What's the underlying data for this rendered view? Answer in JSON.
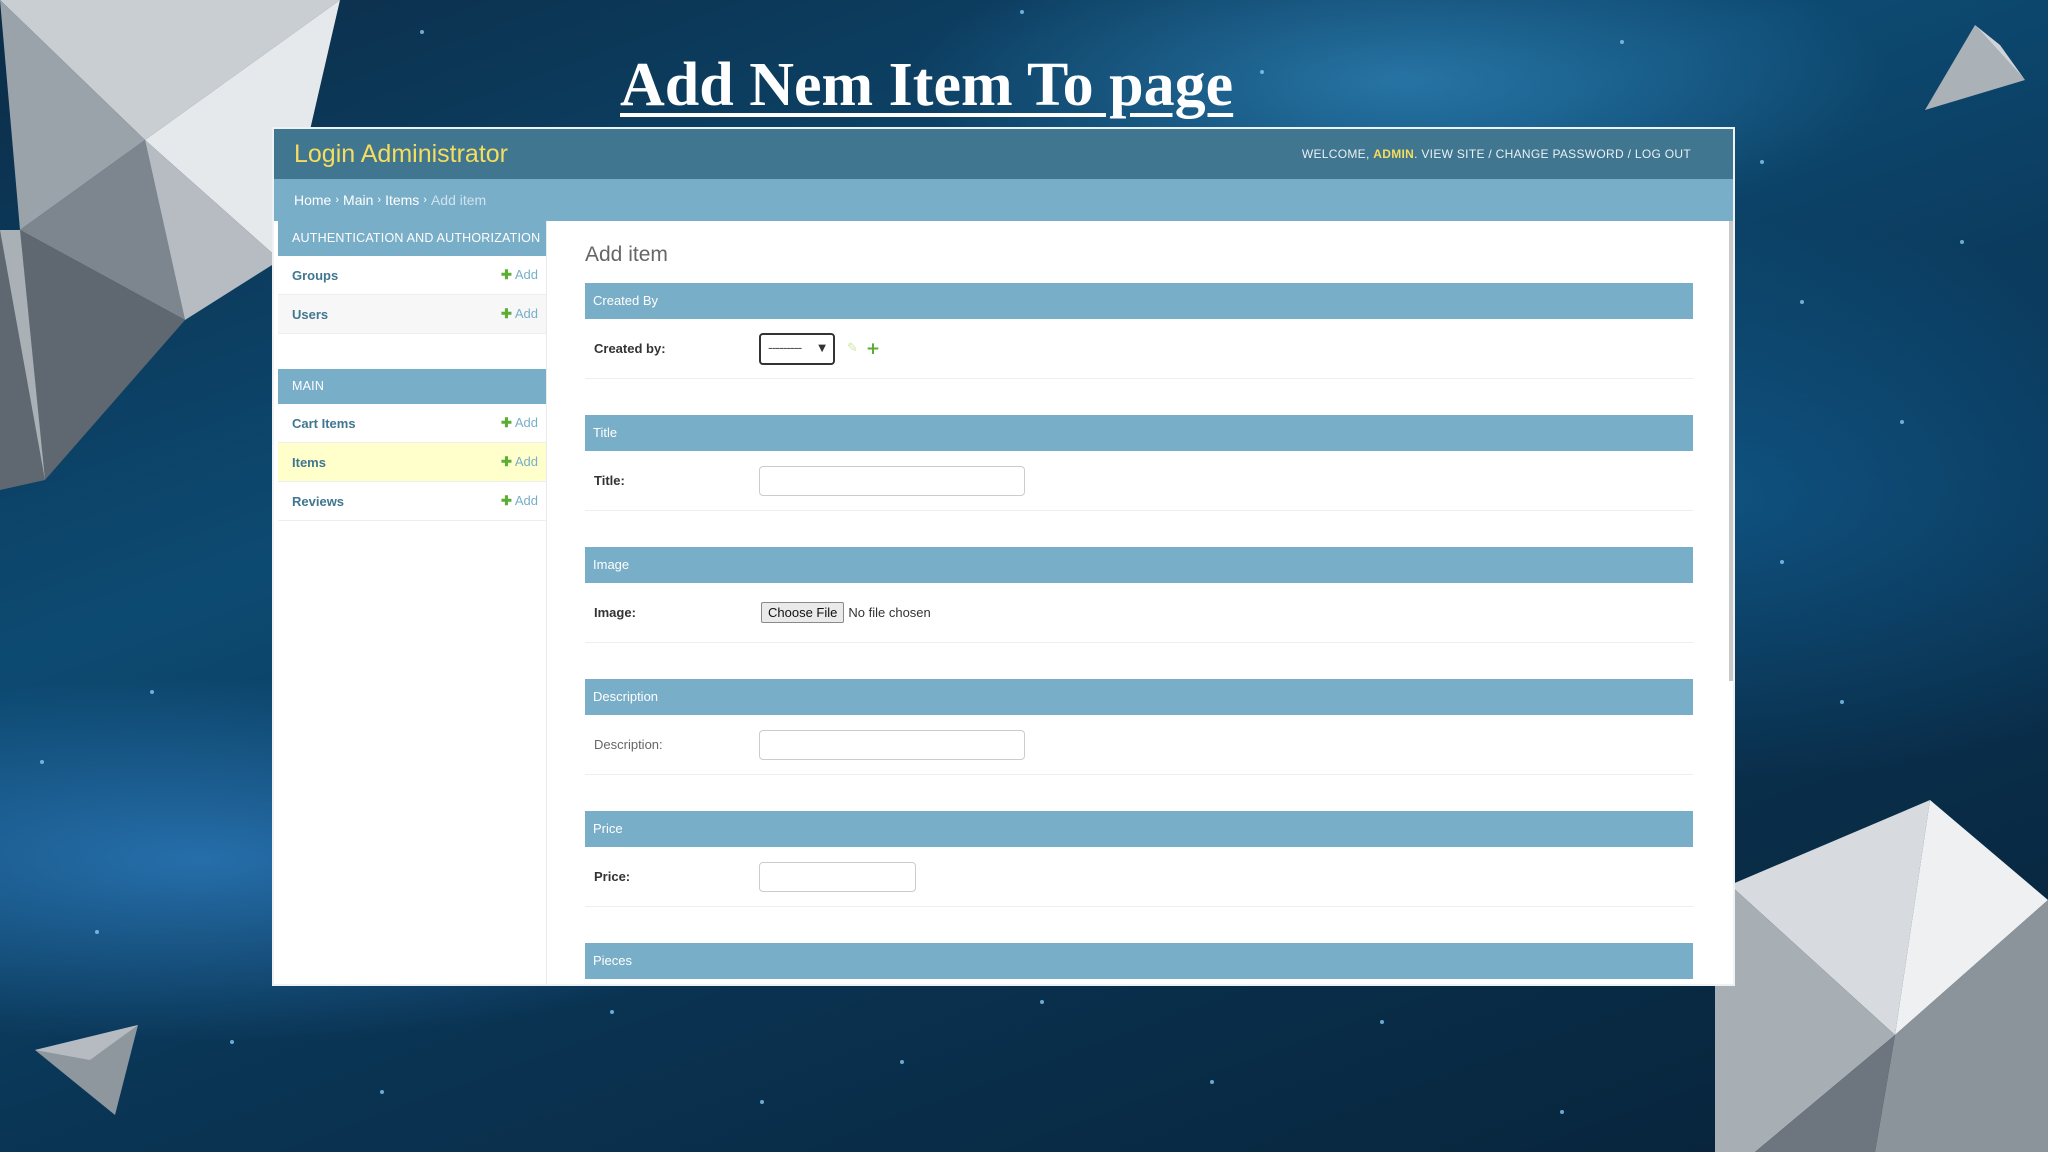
{
  "slide": {
    "title": "Add Nem Item To page"
  },
  "header": {
    "brand": "Login Administrator",
    "welcome": "WELCOME,",
    "username": "ADMIN",
    "view_site": "VIEW SITE",
    "change_password": "CHANGE PASSWORD",
    "log_out": "LOG OUT",
    "separator": "/"
  },
  "breadcrumb": {
    "home": "Home",
    "main": "Main",
    "items": "Items",
    "current": "Add item",
    "sep": "›"
  },
  "sidebar": {
    "auth_caption": "AUTHENTICATION AND AUTHORIZATION",
    "auth_models": [
      {
        "name": "Groups",
        "add": "Add"
      },
      {
        "name": "Users",
        "add": "Add"
      }
    ],
    "main_caption": "MAIN",
    "main_models": [
      {
        "name": "Cart Items",
        "add": "Add"
      },
      {
        "name": "Items",
        "add": "Add"
      },
      {
        "name": "Reviews",
        "add": "Add"
      }
    ]
  },
  "form": {
    "heading": "Add item",
    "created_by": {
      "section": "Created By",
      "label": "Created by:",
      "selected": "---------"
    },
    "title": {
      "section": "Title",
      "label": "Title:",
      "value": ""
    },
    "image": {
      "section": "Image",
      "label": "Image:",
      "button": "Choose File",
      "status": "No file chosen"
    },
    "description": {
      "section": "Description",
      "label": "Description:",
      "value": ""
    },
    "price": {
      "section": "Price",
      "label": "Price:",
      "value": ""
    },
    "pieces": {
      "section": "Pieces"
    }
  },
  "colors": {
    "header_bg": "#417690",
    "caption_bg": "#79aec8",
    "brand": "#f5dd5d",
    "active_row": "#ffffcc",
    "add_plus": "#5bad34"
  }
}
